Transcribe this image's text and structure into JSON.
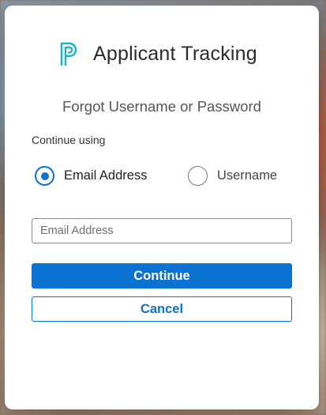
{
  "app": {
    "title": "Applicant Tracking",
    "logo_icon": "powerschool-p-logo-icon"
  },
  "form": {
    "heading": "Forgot Username or Password",
    "continue_using_label": "Continue using",
    "options": [
      {
        "label": "Email Address",
        "selected": true
      },
      {
        "label": "Username",
        "selected": false
      }
    ],
    "email_input": {
      "placeholder": "Email Address",
      "value": ""
    },
    "continue_button": "Continue",
    "cancel_button": "Cancel"
  },
  "colors": {
    "accent": "#0b72d1",
    "logo": "#1fb0c9",
    "card_background": "#ffffff"
  }
}
